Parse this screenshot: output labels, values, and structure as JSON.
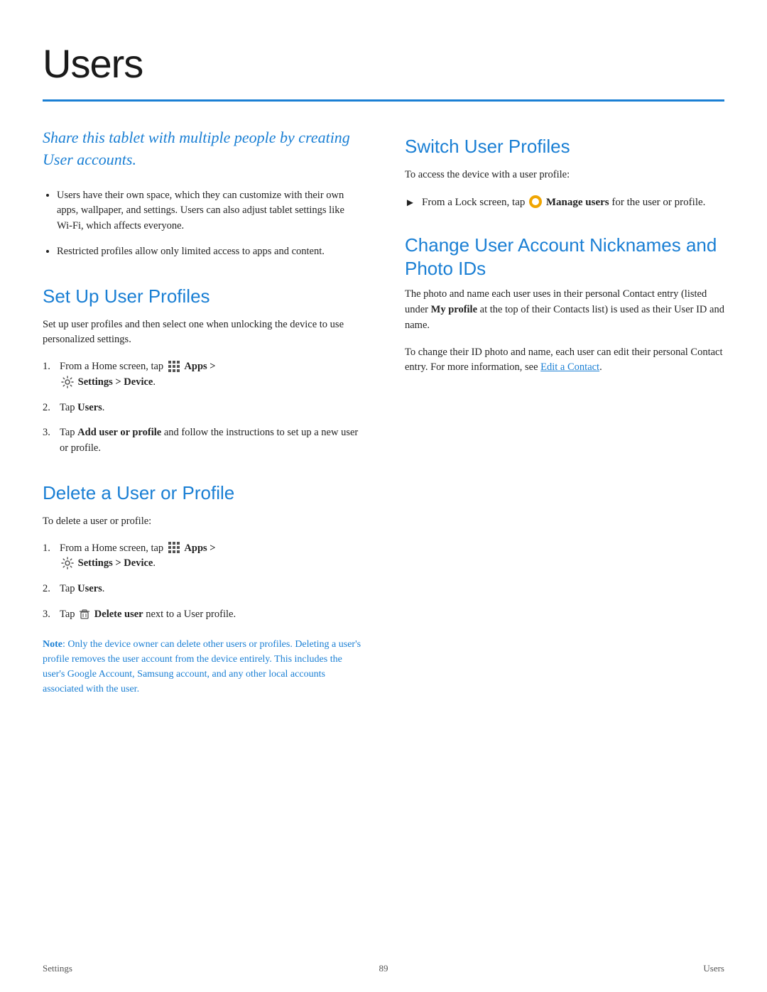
{
  "page": {
    "title": "Users",
    "rule_color": "#1a7fd4"
  },
  "footer": {
    "left": "Settings",
    "center": "89",
    "right": "Users"
  },
  "left_col": {
    "intro": "Share this tablet with multiple people by creating User accounts.",
    "bullets": [
      "Users have their own space, which they can customize with their own apps, wallpaper, and settings. Users can also adjust tablet settings like Wi-Fi, which affects everyone.",
      "Restricted profiles allow only limited access to apps and content."
    ],
    "section1": {
      "title": "Set Up User Profiles",
      "intro": "Set up user profiles and then select one when unlocking the device to use personalized settings.",
      "steps": [
        {
          "num": "1.",
          "text_before": "From a Home screen, tap",
          "apps_label": "Apps >",
          "text_after": "Settings > Device",
          "has_settings_icon": true,
          "bold_part": "Settings > Device"
        },
        {
          "num": "2.",
          "text": "Tap",
          "bold": "Users",
          "text_after": "."
        },
        {
          "num": "3.",
          "text": "Tap",
          "bold": "Add user or profile",
          "text_after": "and follow the instructions to set up a new user or profile."
        }
      ]
    },
    "section2": {
      "title": "Delete a User or Profile",
      "intro": "To delete a user or profile:",
      "steps": [
        {
          "num": "1.",
          "text_before": "From a Home screen, tap",
          "apps_label": "Apps >",
          "has_settings_icon": true,
          "bold_part": "Settings > Device"
        },
        {
          "num": "2.",
          "text": "Tap",
          "bold": "Users",
          "text_after": "."
        },
        {
          "num": "3.",
          "text": "Tap",
          "has_trash": true,
          "bold": "Delete user",
          "text_after": "next to a User profile."
        }
      ],
      "note_label": "Note",
      "note_text": ": Only the device owner can delete other users or profiles. Deleting a user’s profile removes the user account from the device entirely. This includes the user’s Google Account, Samsung account, and any other local accounts associated with the user."
    }
  },
  "right_col": {
    "section1": {
      "title": "Switch User Profiles",
      "intro": "To access the device with a user profile:",
      "bullet": {
        "text_before": "From a Lock screen, tap",
        "bold": "Manage users",
        "text_after": "for the user or profile."
      }
    },
    "section2": {
      "title": "Change User Account Nicknames and Photo IDs",
      "para1": "The photo and name each user uses in their personal Contact entry (listed under",
      "bold1": "My profile",
      "para1_cont": "at the top of their Contacts list) is used as their User ID and name.",
      "para2_before": "To change their ID photo and name, each user can edit their personal Contact entry. For more information, see",
      "link": "Edit a Contact",
      "para2_after": "."
    }
  }
}
